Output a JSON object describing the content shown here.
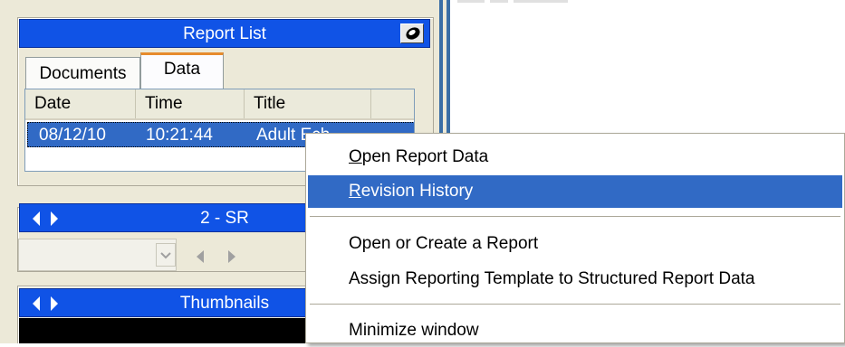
{
  "report_list": {
    "title": "Report List",
    "tabs": [
      "Documents",
      "Data"
    ],
    "active_tab": "Data",
    "columns": [
      "Date",
      "Time",
      "Title"
    ],
    "rows": [
      {
        "date": "08/12/10",
        "time": "10:21:44",
        "title": "Adult Ech"
      }
    ]
  },
  "series_panel": {
    "label": "2 - SR"
  },
  "thumbnails_panel": {
    "title": "Thumbnails"
  },
  "context_menu": {
    "items": [
      {
        "label": "Open Report Data",
        "accel": "O",
        "rest": "pen Report Data",
        "highlighted": false
      },
      {
        "label": "Revision History",
        "accel": "R",
        "rest": "evision History",
        "highlighted": true
      },
      {
        "label": "Open or Create a Report",
        "highlighted": false
      },
      {
        "label": "Assign Reporting Template to Structured Report Data",
        "highlighted": false
      },
      {
        "label": "Minimize window",
        "highlighted": false
      }
    ]
  },
  "colors": {
    "titlebar_blue": "#1053e6",
    "selection_blue": "#316ac5",
    "panel_bg": "#ece9d8",
    "tab_accent": "#e68b2c"
  },
  "icons": [
    "pin-icon",
    "nav-left-icon",
    "nav-right-icon",
    "chevron-down-icon"
  ]
}
